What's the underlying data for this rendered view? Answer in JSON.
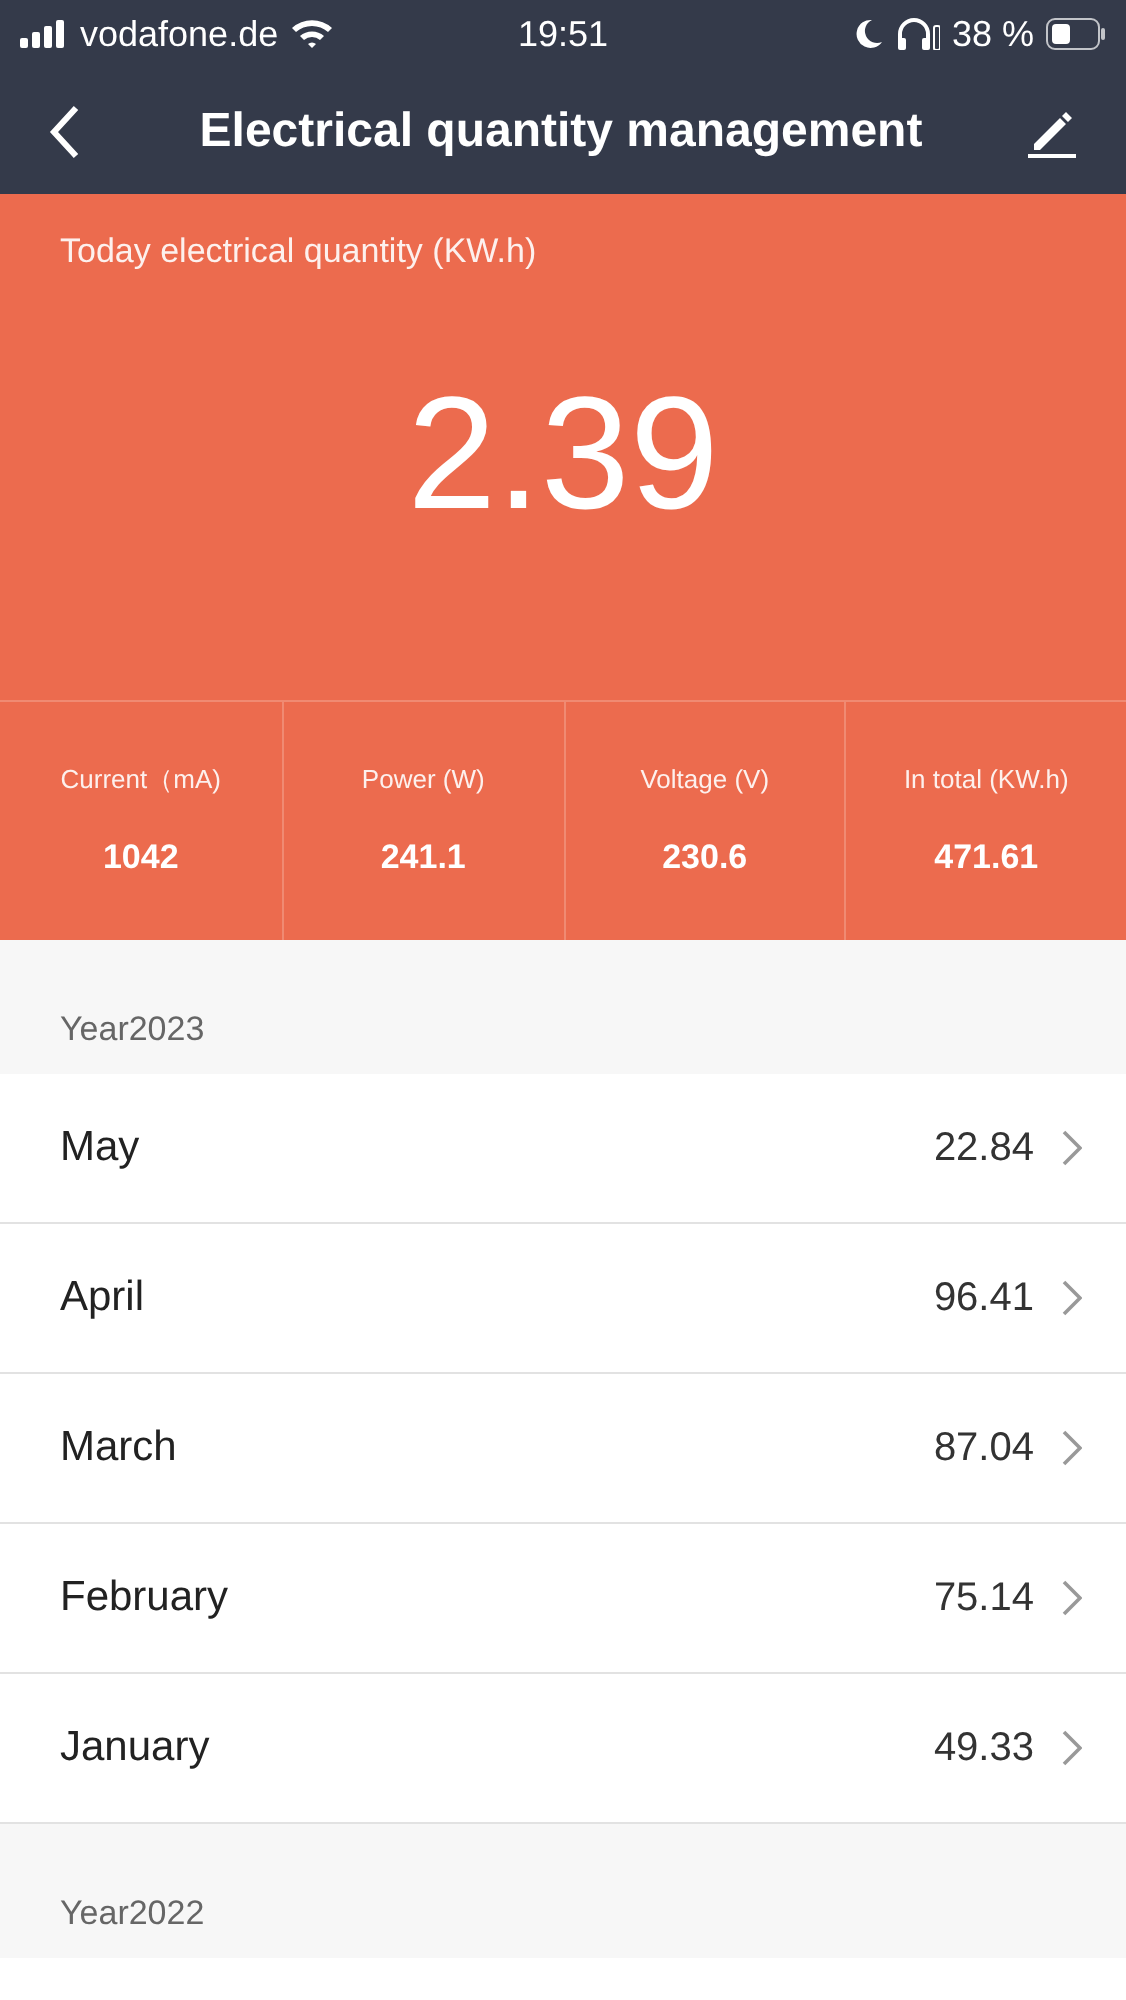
{
  "status_bar": {
    "carrier": "vodafone.de",
    "time": "19:51",
    "battery": "38 %"
  },
  "nav": {
    "title": "Electrical quantity management"
  },
  "today": {
    "label": "Today electrical quantity (KW.h)",
    "value": "2.39"
  },
  "stats": [
    {
      "label": "Current（mA)",
      "value": "1042"
    },
    {
      "label": "Power (W)",
      "value": "241.1"
    },
    {
      "label": "Voltage (V)",
      "value": "230.6"
    },
    {
      "label": "In total (KW.h)",
      "value": "471.61"
    }
  ],
  "years": [
    {
      "title": "Year2023",
      "months": [
        {
          "name": "May",
          "value": "22.84"
        },
        {
          "name": "April",
          "value": "96.41"
        },
        {
          "name": "March",
          "value": "87.04"
        },
        {
          "name": "February",
          "value": "75.14"
        },
        {
          "name": "January",
          "value": "49.33"
        }
      ]
    },
    {
      "title": "Year2022"
    }
  ]
}
